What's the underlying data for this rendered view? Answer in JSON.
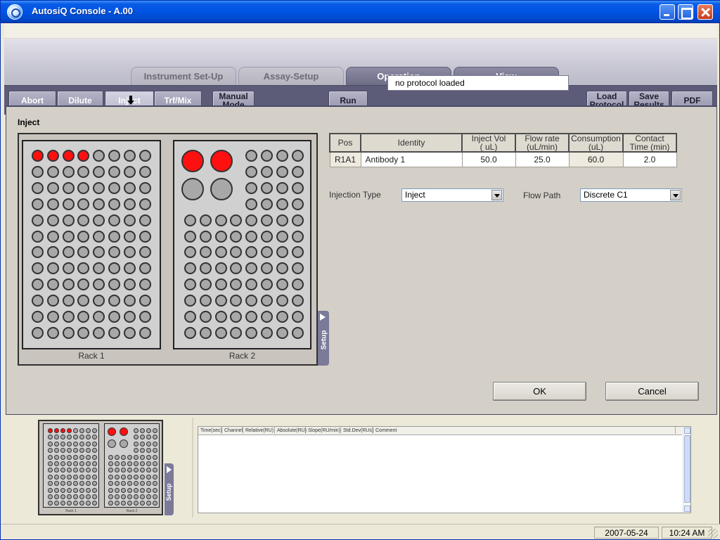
{
  "window": {
    "title": "AutosiQ Console - A.00"
  },
  "tabs": [
    "Instrument Set-Up",
    "Assay-Setup",
    "Operation",
    "View"
  ],
  "active_tab": "Operation",
  "toolbar": {
    "abort": "Abort",
    "dilute": "Dilute",
    "inject": "Inject",
    "trf_mix": "Trf/Mix",
    "manual_1": "Manual",
    "manual_2": "Mode",
    "run": "Run",
    "status": "no protocol loaded",
    "load_1": "Load",
    "load_2": "Protocol",
    "save_1": "Save",
    "save_2": "Results",
    "pdf": "PDF"
  },
  "inject_panel": {
    "title": "Inject",
    "rack1_label": "Rack 1",
    "rack2_label": "Rack 2",
    "setup_label": "Setup",
    "rack1_red_wells": 4,
    "rack2_red_wells": 2
  },
  "inject_table": {
    "headers": {
      "pos": "Pos",
      "identity": "Identity",
      "inject_vol_1": "Inject Vol",
      "inject_vol_2": "( uL)",
      "flow_rate_1": "Flow rate",
      "flow_rate_2": "(uL/min)",
      "consumption_1": "Consumption",
      "consumption_2": "(uL)",
      "contact_1": "Contact",
      "contact_2": "Time (min)"
    },
    "row": {
      "pos": "R1A1",
      "identity": "Antibody 1",
      "inject_vol": "50.0",
      "flow_rate": "25.0",
      "consumption": "60.0",
      "contact_time": "2.0"
    }
  },
  "injection_type": {
    "label": "Injection Type",
    "value": "Inject"
  },
  "flow_path": {
    "label": "Flow Path",
    "value": "Discrete C1"
  },
  "dialog": {
    "ok": "OK",
    "cancel": "Cancel"
  },
  "mini_rack": {
    "rack1_label": "Rack 1",
    "rack2_label": "Rack 2",
    "setup_label": "Setup"
  },
  "results_table": {
    "columns": [
      "Time(sec)",
      "Channel",
      "Relative(RU)",
      "Absolute(RU)",
      "Slope(RU/min)",
      "Std.Dev(RUs)",
      "Comment"
    ]
  },
  "statusbar": {
    "date": "2007-05-24",
    "time": "10:24 AM"
  },
  "colors": {
    "title_bar": "#0054e3",
    "toolbar": "#5d5c78",
    "active_tab": "#6e6d86",
    "well_red": "#ff1010",
    "well_gray": "#a8a8a8"
  }
}
